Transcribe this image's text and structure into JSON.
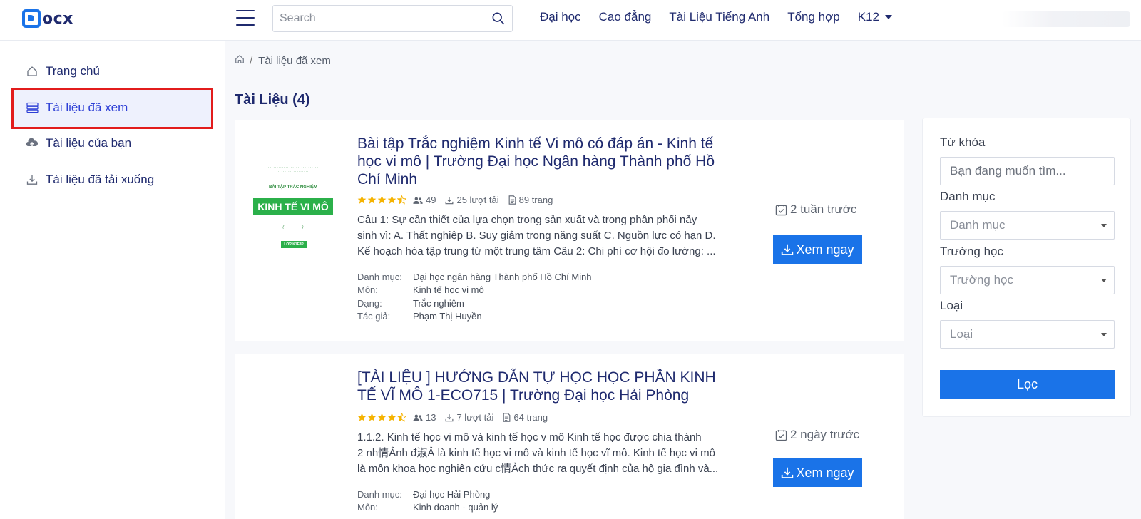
{
  "header": {
    "logo_text": "ocx",
    "search_placeholder": "Search",
    "nav": [
      "Đại học",
      "Cao đẳng",
      "Tài Liệu Tiếng Anh",
      "Tổng hợp",
      "K12"
    ]
  },
  "sidebar": {
    "items": [
      {
        "label": "Trang chủ",
        "icon": "home-icon",
        "active": false
      },
      {
        "label": "Tài liệu đã xem",
        "icon": "stack-icon",
        "active": true
      },
      {
        "label": "Tài liệu của bạn",
        "icon": "cloud-upload-icon",
        "active": false
      },
      {
        "label": "Tài liệu đã tải xuống",
        "icon": "download-icon",
        "active": false
      }
    ]
  },
  "breadcrumb": {
    "current": "Tài liệu đã xem"
  },
  "main": {
    "title": "Tài Liệu (4)"
  },
  "documents": [
    {
      "title_lines": [
        "Bài tập Trắc nghiệm Kinh tế Vi mô có đáp án - Kinh tế",
        "học vi mô | Trường Đại học Ngân hàng Thành phố Hồ",
        "Chí Minh"
      ],
      "rating": 4.5,
      "followers": "49",
      "downloads": "25 lượt tải",
      "pages": "89 trang",
      "excerpt_lines": [
        "Câu 1: Sự cần thiết của lựa chọn trong sản xuất và trong phân phối nảy",
        "sinh vì: A. Thất nghiệp B. Suy giảm trong năng suất C. Nguồn lực có hạn D.",
        "Kế hoạch hóa tập trung từ một trung tâm Câu 2: Chi phí cơ hội đo lường: ..."
      ],
      "info": [
        {
          "k": "Danh mục:",
          "v": "Đại học ngân hàng Thành phố Hồ Chí Minh"
        },
        {
          "k": "Môn:",
          "v": "Kinh tế học vi mô"
        },
        {
          "k": "Dạng:",
          "v": "Trắc nghiệm"
        },
        {
          "k": "Tác giả:",
          "v": "Phạm Thị Huyền"
        }
      ],
      "date": "2 tuần trước",
      "button": "Xem ngay",
      "thumb": {
        "title": "KINH TẾ VI MÔ",
        "badge": "LỚP K1F8P",
        "heading": "BÀI TẬP TRẮC NGHIỆM"
      }
    },
    {
      "title_lines": [
        "[TÀI LIỆU ] HƯỚNG DẪN TỰ HỌC HỌC PHẦN KINH",
        "TẾ VĨ MÔ 1-ECO715 | Trường Đại học Hải Phòng"
      ],
      "rating": 4.5,
      "followers": "13",
      "downloads": "7 lượt tải",
      "pages": "64 trang",
      "excerpt_lines": [
        "1.1.2. Kinh tế học vi mô và kinh tế học v      mô Kinh tế học được chia thành",
        "2 nh情Ảnh đ淑Ả là kinh tế học vi mô và kinh tế học vĩ mô. Kinh tế học vi mô",
        "là môn khoa học nghiên cứu c情Ảch thức ra quyết định của hộ gia đình và..."
      ],
      "info": [
        {
          "k": "Danh mục:",
          "v": "Đại học Hải Phòng"
        },
        {
          "k": "Môn:",
          "v": "Kinh doanh - quản lý"
        }
      ],
      "date": "2 ngày trước",
      "button": "Xem ngay"
    }
  ],
  "filter": {
    "keyword_label": "Từ khóa",
    "keyword_placeholder": "Bạn đang muốn tìm...",
    "category_label": "Danh mục",
    "category_value": "Danh mục",
    "school_label": "Trường học",
    "school_value": "Trường học",
    "type_label": "Loại",
    "type_value": "Loại",
    "submit": "Lọc"
  },
  "colors": {
    "accent": "#1a73e8",
    "nav_text": "#1f2a6e",
    "active_outline": "#e21c1c",
    "star": "#f5b301"
  }
}
